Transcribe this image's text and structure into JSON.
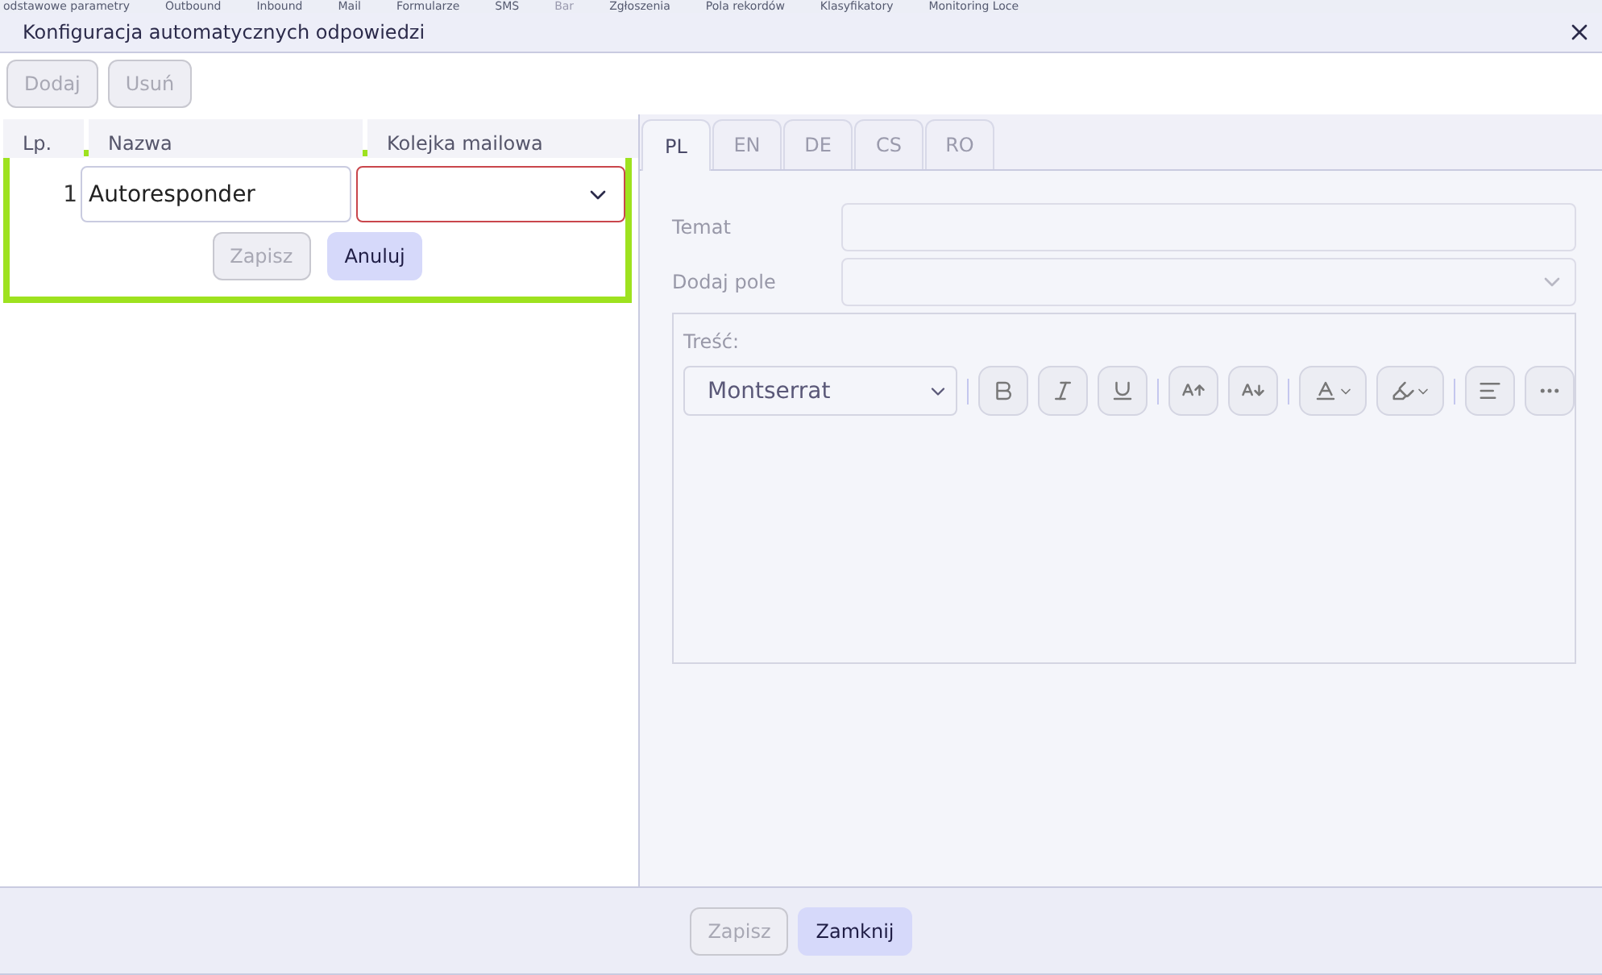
{
  "background_tabs": [
    {
      "label": "odstawowe parametry",
      "disabled": false
    },
    {
      "label": "Outbound",
      "disabled": false
    },
    {
      "label": "Inbound",
      "disabled": false
    },
    {
      "label": "Mail",
      "disabled": false
    },
    {
      "label": "Formularze",
      "disabled": false
    },
    {
      "label": "SMS",
      "disabled": false
    },
    {
      "label": "Bar",
      "disabled": true
    },
    {
      "label": "Zgłoszenia",
      "disabled": false
    },
    {
      "label": "Pola rekordów",
      "disabled": false
    },
    {
      "label": "Klasyfikatory",
      "disabled": false
    },
    {
      "label": "Monitoring Loce",
      "disabled": false
    }
  ],
  "window": {
    "title": "Konfiguracja automatycznych odpowiedzi"
  },
  "toolbar": [
    {
      "label": "Dodaj",
      "disabled": true
    },
    {
      "label": "Usuń",
      "disabled": true
    }
  ],
  "table": {
    "columns": [
      "Lp.",
      "Nazwa",
      "Kolejka mailowa"
    ],
    "edit_row": {
      "number": "1",
      "name_value": "Autoresponder",
      "queue_invalid": true,
      "highlighted": true,
      "buttons": [
        {
          "label": "Zapisz",
          "kind": "outline",
          "disabled": true
        },
        {
          "label": "Anuluj",
          "kind": "primary",
          "disabled": false
        }
      ]
    }
  },
  "language_tabs": [
    {
      "label": "PL",
      "selected": true
    },
    {
      "label": "EN",
      "selected": false
    },
    {
      "label": "DE",
      "selected": false
    },
    {
      "label": "CS",
      "selected": false
    },
    {
      "label": "RO",
      "selected": false
    }
  ],
  "form": {
    "subject_label": "Temat",
    "field_label": "Dodaj pole",
    "body_label": "Treść:",
    "font": "Montserrat",
    "disabled": true
  },
  "footer": [
    {
      "label": "Zapisz",
      "kind": "outline",
      "disabled": true
    },
    {
      "label": "Zamknij",
      "kind": "primary",
      "disabled": false
    }
  ]
}
